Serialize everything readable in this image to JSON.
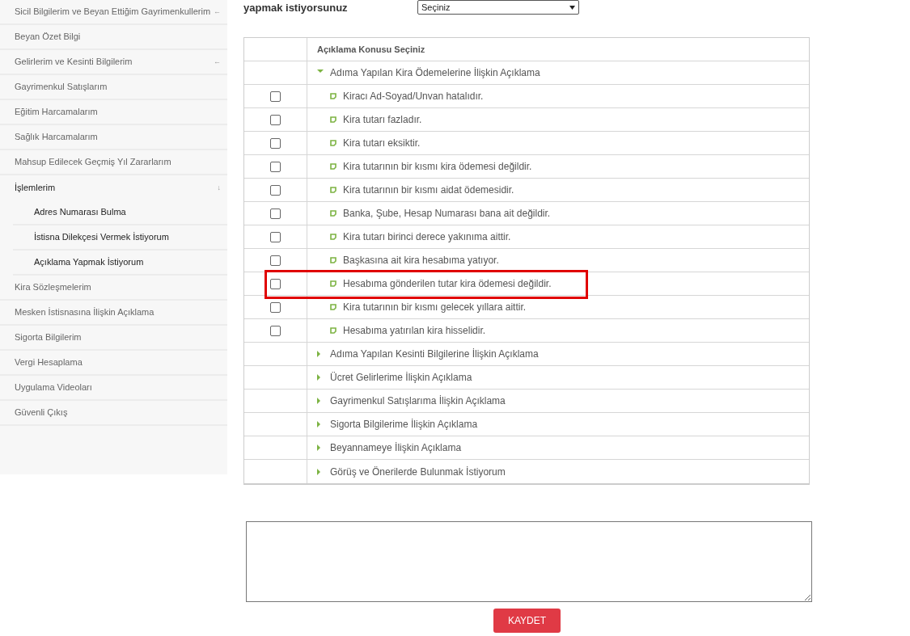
{
  "sidebar": {
    "items": [
      {
        "label": "Sicil Bilgilerim ve Beyan Ettiğim Gayrimenkullerim",
        "arrow": "←",
        "selected": false
      },
      {
        "label": "Beyan Özet Bilgi",
        "selected": false
      },
      {
        "label": "Gelirlerim ve Kesinti Bilgilerim",
        "arrow": "←",
        "selected": false
      },
      {
        "label": "Gayrimenkul Satışlarım",
        "selected": false
      },
      {
        "label": "Eğitim Harcamalarım",
        "selected": false
      },
      {
        "label": "Sağlık Harcamalarım",
        "selected": false
      },
      {
        "label": "Mahsup Edilecek Geçmiş Yıl Zararlarım",
        "selected": false
      },
      {
        "label": "İşlemlerim",
        "arrow": "↓",
        "selected": true,
        "children": [
          {
            "label": "Adres Numarası Bulma"
          },
          {
            "label": "İstisna Dilekçesi Vermek İstiyorum"
          },
          {
            "label": "Açıklama Yapmak İstiyorum"
          }
        ]
      },
      {
        "label": "Kira Sözleşmelerim",
        "selected": false
      },
      {
        "label": "Mesken İstisnasına İlişkin Açıklama",
        "selected": false
      },
      {
        "label": "Sigorta Bilgilerim",
        "selected": false
      },
      {
        "label": "Vergi Hesaplama",
        "selected": false
      },
      {
        "label": "Uygulama Videoları",
        "selected": false
      },
      {
        "label": "Güvenli Çıkış",
        "selected": false
      }
    ]
  },
  "question": {
    "label": "yapmak istiyorsunuz",
    "select_value": "Seçiniz"
  },
  "table": {
    "header": "Açıklama Konusu Seçiniz",
    "groups": [
      {
        "label": "Adıma Yapılan Kira Ödemelerine İlişkin Açıklama",
        "expanded": true,
        "children": [
          {
            "label": "Kiracı Ad-Soyad/Unvan hatalıdır.",
            "checked": false,
            "highlighted": false
          },
          {
            "label": "Kira tutarı fazladır.",
            "checked": false,
            "highlighted": false
          },
          {
            "label": "Kira tutarı eksiktir.",
            "checked": false,
            "highlighted": false
          },
          {
            "label": "Kira tutarının bir kısmı kira ödemesi değildir.",
            "checked": false,
            "highlighted": false
          },
          {
            "label": "Kira tutarının bir kısmı aidat ödemesidir.",
            "checked": false,
            "highlighted": false
          },
          {
            "label": "Banka, Şube, Hesap Numarası bana ait değildir.",
            "checked": false,
            "highlighted": false
          },
          {
            "label": "Kira tutarı birinci derece yakınıma aittir.",
            "checked": false,
            "highlighted": false
          },
          {
            "label": "Başkasına ait kira hesabıma yatıyor.",
            "checked": false,
            "highlighted": false
          },
          {
            "label": "Hesabıma gönderilen tutar kira ödemesi değildir.",
            "checked": false,
            "highlighted": true
          },
          {
            "label": "Kira tutarının bir kısmı gelecek yıllara aittir.",
            "checked": false,
            "highlighted": false
          },
          {
            "label": "Hesabıma yatırılan kira hisselidir.",
            "checked": false,
            "highlighted": false
          }
        ]
      },
      {
        "label": "Adıma Yapılan Kesinti Bilgilerine İlişkin Açıklama",
        "expanded": false
      },
      {
        "label": "Ücret Gelirlerime İlişkin Açıklama",
        "expanded": false
      },
      {
        "label": "Gayrimenkul Satışlarıma İlişkin Açıklama",
        "expanded": false
      },
      {
        "label": "Sigorta Bilgilerime İlişkin Açıklama",
        "expanded": false
      },
      {
        "label": "Beyannameye İlişkin Açıklama",
        "expanded": false
      },
      {
        "label": "Görüş ve Önerilerde Bulunmak İstiyorum",
        "expanded": false
      }
    ]
  },
  "save_button": "KAYDET"
}
